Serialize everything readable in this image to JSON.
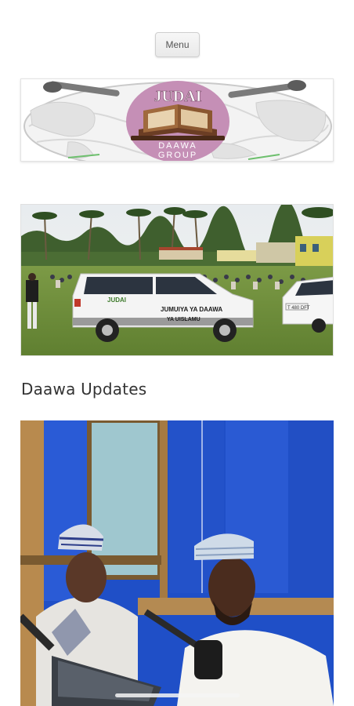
{
  "header": {
    "menu_label": "Menu"
  },
  "logo": {
    "title": "JUDAI",
    "subtitle_line1": "DAAWA",
    "subtitle_line2": "GROUP"
  },
  "banner_photo": {
    "van_brand": "JUDAI",
    "van_text_line1": "JUMUIYA YA DAAWA",
    "van_text_line2": "YA UISLAMU",
    "plate": "T 480 DFT"
  },
  "section": {
    "heading": "Daawa Updates"
  },
  "colors": {
    "logo_circle": "#c58fb6",
    "studio_blue": "#1f4fc7",
    "grass": "#6d8d3a"
  }
}
